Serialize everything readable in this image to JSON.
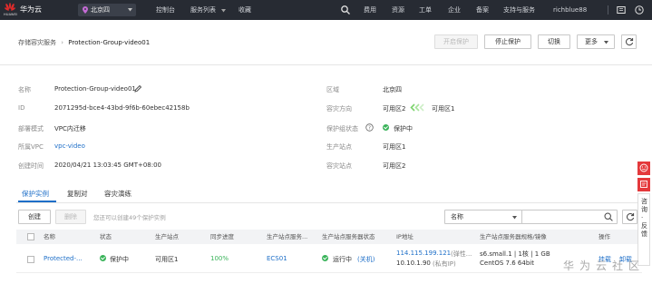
{
  "topbar": {
    "brand": "华为云",
    "brand_sub": "HUAWEI",
    "region": "北京四",
    "console": "控制台",
    "service_list": "服务列表",
    "favorites": "收藏",
    "fees": "费用",
    "resources": "资源",
    "ticket": "工单",
    "enterprise": "企业",
    "filing": "备案",
    "support": "支持与服务",
    "user": "richblue88"
  },
  "breadcrumb": {
    "parent": "存储容灾服务",
    "current": "Protection-Group-video01"
  },
  "actions": {
    "enable_protection": "开启保护",
    "stop_protection": "停止保护",
    "switch": "切换",
    "more": "更多"
  },
  "details_left": [
    {
      "label": "名称",
      "value": "Protection-Group-video01"
    },
    {
      "label": "ID",
      "value": "2071295d-bce4-43bd-9f6b-60ebec42158b"
    },
    {
      "label": "部署模式",
      "value": "VPC内迁移"
    },
    {
      "label": "所属VPC",
      "value": "vpc-video"
    },
    {
      "label": "创建时间",
      "value": "2020/04/21 13:03:45 GMT+08:00"
    }
  ],
  "details_right": [
    {
      "label": "区域",
      "value": "北京四"
    },
    {
      "label": "容灾方向",
      "from": "可用区2",
      "to": "可用区1"
    },
    {
      "label": "保护组状态",
      "value": "保护中"
    },
    {
      "label": "生产站点",
      "value": "可用区1"
    },
    {
      "label": "容灾站点",
      "value": "可用区2"
    }
  ],
  "tabs": [
    "保护实例",
    "复制对",
    "容灾演练"
  ],
  "toolbar": {
    "create": "创建",
    "delete": "删除",
    "hint": "您还可以创建49个保护实例",
    "filter_field": "名称"
  },
  "table": {
    "headers": [
      "名称",
      "状态",
      "生产站点",
      "同步进度",
      "生产站点服务...",
      "生产站点服务器状态",
      "IP地址",
      "生产站点服务器规格/镜像",
      "操作"
    ],
    "row": {
      "name": "Protected-...",
      "status": "保护中",
      "site": "可用区1",
      "progress": "100%",
      "server": "ECS01",
      "server_status": "运行中",
      "server_status_note": "(关机)",
      "ip_float": "114.115.199.121",
      "ip_float_note": "(弹性...",
      "ip_private": "10.10.1.90",
      "ip_private_note": "(私有IP)",
      "spec": "s6.small.1 | 1核 | 1 GB",
      "image": "CentOS 7.6 64bit",
      "ops": "挂载",
      "ops2": "卸载"
    }
  },
  "side": {
    "feedback": "咨询·反馈"
  },
  "watermark": "华为云社区"
}
